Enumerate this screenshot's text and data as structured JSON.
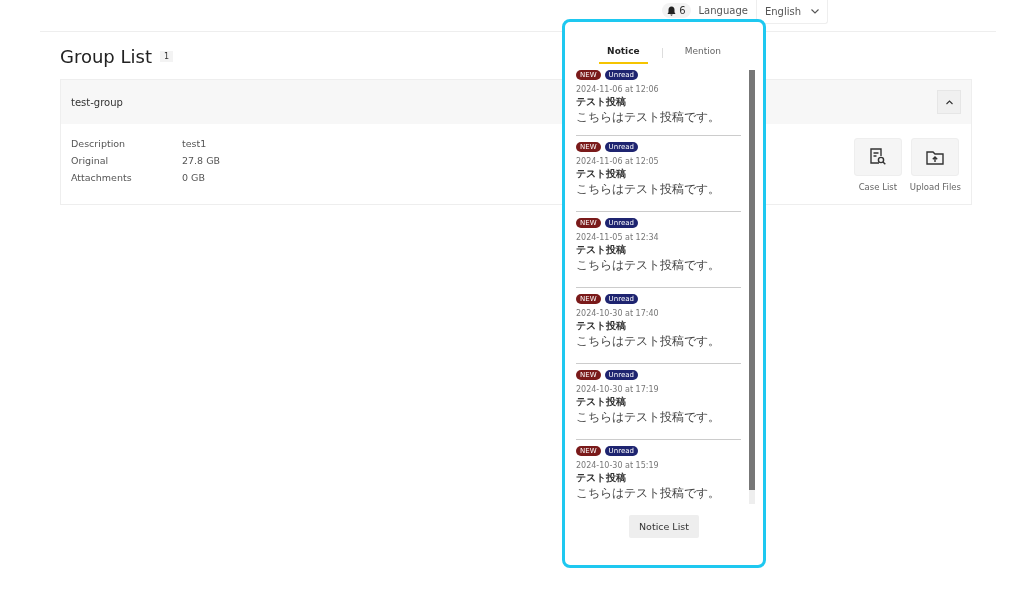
{
  "header": {
    "notification_count": "6",
    "language_label": "Language",
    "language": "English"
  },
  "page": {
    "title": "Group List",
    "count": "1"
  },
  "group": {
    "name": "test-group",
    "expanded": true,
    "fields": [
      {
        "label": "Description",
        "value": "test1"
      },
      {
        "label": "Original",
        "value": "27.8 GB"
      },
      {
        "label": "Attachments",
        "value": "0 GB"
      }
    ],
    "actions": [
      {
        "kind": "case",
        "label": "Case List"
      },
      {
        "kind": "upload",
        "label": "Upload Files"
      }
    ]
  },
  "notice_panel": {
    "tabs": [
      {
        "label": "Notice",
        "selected": true
      },
      {
        "label": "Mention",
        "selected": false
      }
    ],
    "items": [
      {
        "badges": [
          {
            "kind": "new",
            "text": "NEW"
          },
          {
            "kind": "unread",
            "text": "Unread"
          }
        ],
        "date": "2024-11-06 at 12:06",
        "title": "テスト投稿",
        "body": "こちらはテスト投稿です。"
      },
      {
        "badges": [
          {
            "kind": "new",
            "text": "NEW"
          },
          {
            "kind": "unread",
            "text": "Unread"
          }
        ],
        "date": "2024-11-06 at 12:05",
        "title": "テスト投稿",
        "body": "こちらはテスト投稿です。"
      },
      {
        "badges": [
          {
            "kind": "new",
            "text": "NEW"
          },
          {
            "kind": "unread",
            "text": "Unread"
          }
        ],
        "date": "2024-11-05 at 12:34",
        "title": "テスト投稿",
        "body": "こちらはテスト投稿です。"
      },
      {
        "badges": [
          {
            "kind": "new",
            "text": "NEW"
          },
          {
            "kind": "unread",
            "text": "Unread"
          }
        ],
        "date": "2024-10-30 at 17:40",
        "title": "テスト投稿",
        "body": "こちらはテスト投稿です。"
      },
      {
        "badges": [
          {
            "kind": "new",
            "text": "NEW"
          },
          {
            "kind": "unread",
            "text": "Unread"
          }
        ],
        "date": "2024-10-30 at 17:19",
        "title": "テスト投稿",
        "body": "こちらはテスト投稿です。"
      },
      {
        "badges": [
          {
            "kind": "new",
            "text": "NEW"
          },
          {
            "kind": "unread",
            "text": "Unread"
          }
        ],
        "date": "2024-10-30 at 15:19",
        "title": "テスト投稿",
        "body": "こちらはテスト投稿です。"
      }
    ],
    "button": "Notice List"
  }
}
